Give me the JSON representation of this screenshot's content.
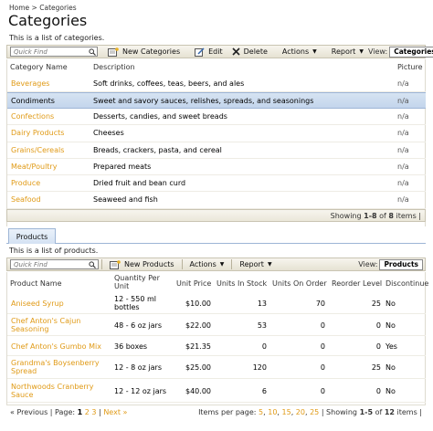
{
  "breadcrumb": {
    "home": "Home",
    "sep": ">",
    "current": "Categories"
  },
  "page": {
    "title": "Categories",
    "description": "This is a list of categories."
  },
  "toolbar": {
    "quick_find_placeholder": "Quick Find",
    "new_label": "New Categories",
    "edit_label": "Edit",
    "delete_label": "Delete",
    "actions_label": "Actions",
    "report_label": "Report",
    "view_label": "View:",
    "view_value": "Categories"
  },
  "categories": {
    "headers": {
      "name": "Category Name",
      "description": "Description",
      "picture": "Picture"
    },
    "rows": [
      {
        "name": "Beverages",
        "description": "Soft drinks, coffees, teas, beers, and ales",
        "picture": "n/a"
      },
      {
        "name": "Condiments",
        "description": "Sweet and savory sauces, relishes, spreads, and seasonings",
        "picture": "n/a"
      },
      {
        "name": "Confections",
        "description": "Desserts, candies, and sweet breads",
        "picture": "n/a"
      },
      {
        "name": "Dairy Products",
        "description": "Cheeses",
        "picture": "n/a"
      },
      {
        "name": "Grains/Cereals",
        "description": "Breads, crackers, pasta, and cereal",
        "picture": "n/a"
      },
      {
        "name": "Meat/Poultry",
        "description": "Prepared meats",
        "picture": "n/a"
      },
      {
        "name": "Produce",
        "description": "Dried fruit and bean curd",
        "picture": "n/a"
      },
      {
        "name": "Seafood",
        "description": "Seaweed and fish",
        "picture": "n/a"
      }
    ],
    "pager": {
      "showing": "Showing",
      "range": "1-8",
      "of": "of",
      "total": "8",
      "items": "items |"
    }
  },
  "products_tab": {
    "label": "Products",
    "description": "This is a list of products."
  },
  "products_toolbar": {
    "quick_find_placeholder": "Quick Find",
    "new_label": "New Products",
    "actions_label": "Actions",
    "report_label": "Report",
    "view_label": "View:",
    "view_value": "Products"
  },
  "products": {
    "headers": {
      "name": "Product Name",
      "qty_line1": "Quantity Per",
      "qty_line2": "Unit",
      "price": "Unit Price",
      "stock": "Units In Stock",
      "order": "Units On Order",
      "reorder": "Reorder Level",
      "disc": "Discontinue"
    },
    "rows": [
      {
        "name1": "Aniseed Syrup",
        "name2": "",
        "qty1": "12 - 550 ml",
        "qty2": "bottles",
        "price": "$10.00",
        "stock": "13",
        "order": "70",
        "reorder": "25",
        "disc": "No"
      },
      {
        "name1": "Chef Anton's Cajun",
        "name2": "Seasoning",
        "qty1": "48 - 6 oz jars",
        "qty2": "",
        "price": "$22.00",
        "stock": "53",
        "order": "0",
        "reorder": "0",
        "disc": "No"
      },
      {
        "name1": "Chef Anton's Gumbo Mix",
        "name2": "",
        "qty1": "36 boxes",
        "qty2": "",
        "price": "$21.35",
        "stock": "0",
        "order": "0",
        "reorder": "0",
        "disc": "Yes"
      },
      {
        "name1": "Grandma's Boysenberry",
        "name2": "Spread",
        "qty1": "12 - 8 oz jars",
        "qty2": "",
        "price": "$25.00",
        "stock": "120",
        "order": "0",
        "reorder": "25",
        "disc": "No"
      },
      {
        "name1": "Northwoods Cranberry",
        "name2": "Sauce",
        "qty1": "12 - 12 oz jars",
        "qty2": "",
        "price": "$40.00",
        "stock": "6",
        "order": "0",
        "reorder": "0",
        "disc": "No"
      }
    ],
    "pager": {
      "previous": "« Previous",
      "page_label": "| Page:",
      "pages": [
        "1",
        "2",
        "3"
      ],
      "next": "| Next »",
      "per_page_label": "Items per page:",
      "per_page": [
        "5",
        "10",
        "15",
        "20",
        "25"
      ],
      "showing": "| Showing",
      "range": "1-5",
      "of": "of",
      "total": "12",
      "items": "items |"
    }
  },
  "colors": {
    "link": "#e09a16",
    "selected_row": "#c3d5ec",
    "toolbar": "#ebe7da"
  }
}
